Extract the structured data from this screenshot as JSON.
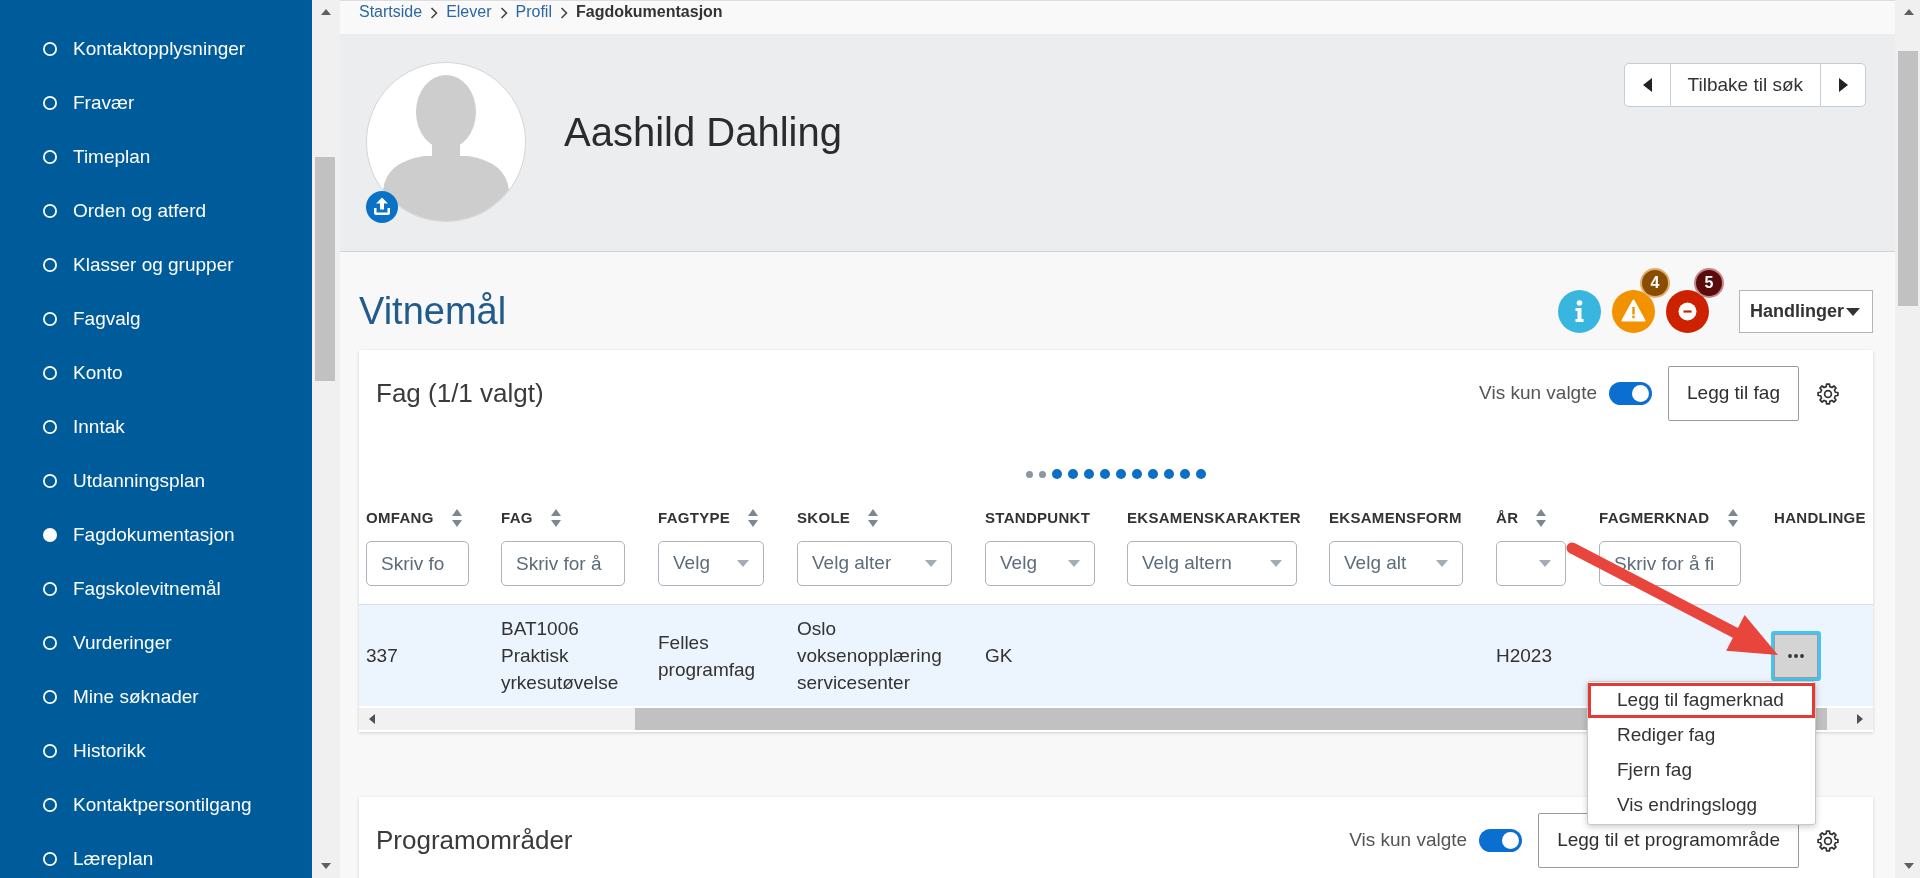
{
  "sidebar": {
    "items": [
      {
        "label": "Kontaktopplysninger",
        "selected": false
      },
      {
        "label": "Fravær",
        "selected": false
      },
      {
        "label": "Timeplan",
        "selected": false
      },
      {
        "label": "Orden og atferd",
        "selected": false
      },
      {
        "label": "Klasser og grupper",
        "selected": false
      },
      {
        "label": "Fagvalg",
        "selected": false
      },
      {
        "label": "Konto",
        "selected": false
      },
      {
        "label": "Inntak",
        "selected": false
      },
      {
        "label": "Utdanningsplan",
        "selected": false
      },
      {
        "label": "Fagdokumentasjon",
        "selected": true
      },
      {
        "label": "Fagskolevitnemål",
        "selected": false
      },
      {
        "label": "Vurderinger",
        "selected": false
      },
      {
        "label": "Mine søknader",
        "selected": false
      },
      {
        "label": "Historikk",
        "selected": false
      },
      {
        "label": "Kontaktpersontilgang",
        "selected": false
      },
      {
        "label": "Læreplan",
        "selected": false
      }
    ]
  },
  "breadcrumb": [
    {
      "label": "Startside",
      "current": false
    },
    {
      "label": "Elever",
      "current": false
    },
    {
      "label": "Profil",
      "current": false
    },
    {
      "label": "Fagdokumentasjon",
      "current": true
    }
  ],
  "profile": {
    "name": "Aashild Dahling",
    "nav_label": "Tilbake til søk"
  },
  "section": {
    "title": "Vitnemål",
    "alerts": [
      {
        "kind": "info"
      },
      {
        "kind": "warning",
        "count": "4"
      },
      {
        "kind": "error",
        "count": "5"
      }
    ],
    "actions_button": "Handlinger"
  },
  "cards": [
    {
      "title": "Fag (1/1 valgt)",
      "toggle": {
        "label": "Vis kun valgte",
        "on": true
      },
      "add_button": "Legg til fag",
      "table": {
        "page_dots": [
          {
            "active": false
          },
          {
            "active": false
          },
          {
            "active": true
          },
          {
            "active": true
          },
          {
            "active": true
          },
          {
            "active": true
          },
          {
            "active": true
          },
          {
            "active": true
          },
          {
            "active": true
          },
          {
            "active": true
          },
          {
            "active": true
          },
          {
            "active": true
          }
        ],
        "columns": [
          {
            "kind": "data",
            "label": "OMFANG",
            "sortable": true,
            "filter": {
              "kind": "text",
              "placeholder": "Skriv fo"
            }
          },
          {
            "kind": "data",
            "label": "FAG",
            "sortable": true,
            "filter": {
              "kind": "text",
              "placeholder": "Skriv for å"
            }
          },
          {
            "kind": "data",
            "label": "FAGTYPE",
            "sortable": true,
            "filter": {
              "kind": "select",
              "placeholder": "Velg"
            }
          },
          {
            "kind": "data",
            "label": "SKOLE",
            "sortable": true,
            "filter": {
              "kind": "select",
              "placeholder": "Velg alter"
            }
          },
          {
            "kind": "data",
            "label": "STANDPUNKT",
            "sortable": false,
            "filter": {
              "kind": "select",
              "placeholder": "Velg"
            }
          },
          {
            "kind": "data",
            "label": "EKSAMENSKARAKTER",
            "sortable": false,
            "filter": {
              "kind": "select",
              "placeholder": "Velg altern"
            }
          },
          {
            "kind": "data",
            "label": "EKSAMENSFORM",
            "sortable": false,
            "filter": {
              "kind": "select",
              "placeholder": "Velg alt"
            }
          },
          {
            "kind": "data",
            "label": "ÅR",
            "sortable": true,
            "filter": {
              "kind": "select"
            }
          },
          {
            "kind": "data",
            "label": "FAGMERKNAD",
            "sortable": true,
            "filter": {
              "kind": "text",
              "placeholder": "Skriv for å fi"
            }
          },
          {
            "kind": "actions",
            "label": "HANDLINGE",
            "sortable": false
          }
        ],
        "rows": [
          {
            "selected": true,
            "cells": [
              "337",
              "BAT1006 Praktisk yrkesutøvelse",
              "Felles programfag",
              "Oslo voksenopplæring servicesenter",
              "GK",
              null,
              null,
              "H2023",
              null
            ],
            "menu": {
              "expanded": true,
              "items": [
                {
                  "label": "Legg til fagmerknad",
                  "highlighted": true
                },
                {
                  "label": "Rediger fag",
                  "highlighted": false
                },
                {
                  "label": "Fjern fag",
                  "highlighted": false
                },
                {
                  "label": "Vis endringslogg",
                  "highlighted": false
                }
              ]
            }
          }
        ]
      }
    },
    {
      "title": "Programområder",
      "toggle": {
        "label": "Vis kun valgte",
        "on": true
      },
      "add_button": "Legg til et programområde"
    }
  ]
}
